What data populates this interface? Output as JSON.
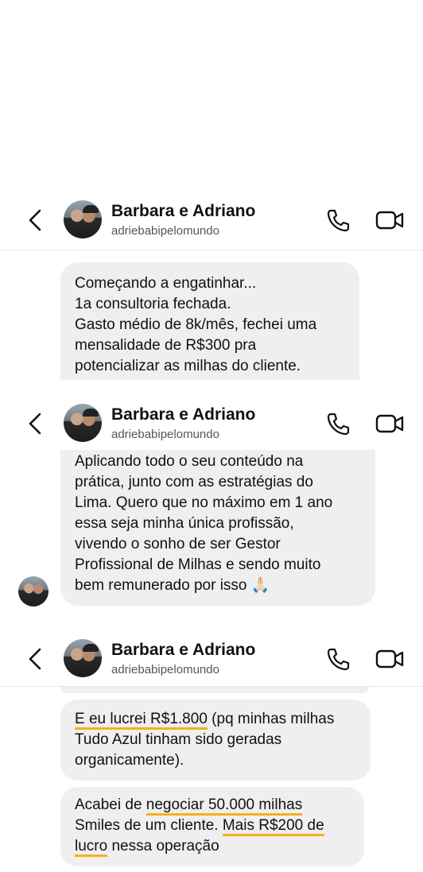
{
  "chat": {
    "name": "Barbara e Adriano",
    "handle": "adriebabipelomundo"
  },
  "message1": {
    "lines": [
      "Começando a engatinhar...",
      "1a consultoria fechada.",
      "Gasto médio de 8k/mês, fechei uma",
      "mensalidade de R$300 pra",
      "potencializar as milhas do cliente."
    ]
  },
  "message2": {
    "lines": [
      "Aplicando todo o seu conteúdo na",
      "prática, junto com as estratégias do",
      "Lima. Quero que no máximo em 1 ano",
      "essa seja minha única profissão,",
      "vivendo o sonho de ser Gestor",
      "Profissional de Milhas e sendo muito",
      "bem remunerado por isso 🙏🏻"
    ]
  },
  "message3": {
    "l1_hl": "E eu lucrei R$1.800",
    "l1_rest": " (pq minhas milhas",
    "l2": "Tudo Azul tinham sido geradas",
    "l3": "organicamente)."
  },
  "message4": {
    "l1_pre": "Acabei de ",
    "l1_hl": "negociar 50.000 milhas",
    "l2_pre": "Smiles de um cliente. ",
    "l2_hl": "Mais R$200 de",
    "l3_hl": "lucro",
    "l3_rest": " nessa operação"
  },
  "colors": {
    "highlight": "#f2b21b",
    "bubble": "#efefef"
  },
  "icons": [
    "back-chevron-icon",
    "phone-icon",
    "video-camera-icon"
  ]
}
